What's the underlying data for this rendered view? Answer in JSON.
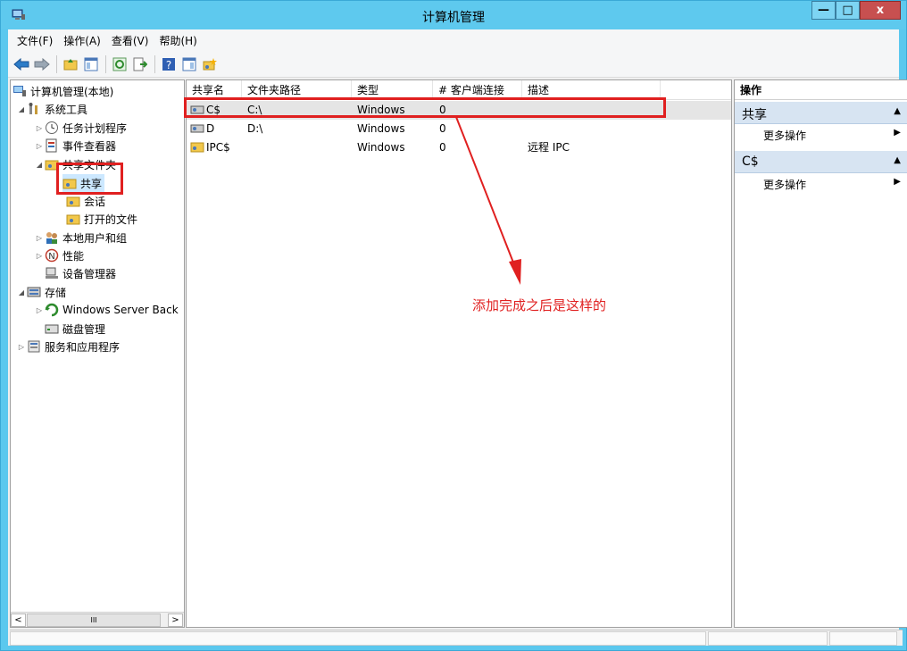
{
  "window": {
    "title": "计算机管理",
    "minimize": "—",
    "maximize": "□",
    "close": "x"
  },
  "menu": [
    "文件(F)",
    "操作(A)",
    "查看(V)",
    "帮助(H)"
  ],
  "tree": {
    "root": "计算机管理(本地)",
    "system_tools": "系统工具",
    "task_scheduler": "任务计划程序",
    "event_viewer": "事件查看器",
    "shared_folders": "共享文件夹",
    "shares": "共享",
    "sessions": "会话",
    "open_files": "打开的文件",
    "local_users": "本地用户和组",
    "performance": "性能",
    "device_manager": "设备管理器",
    "storage": "存储",
    "windows_backup": "Windows Server Back",
    "disk_mgmt": "磁盘管理",
    "services_apps": "服务和应用程序",
    "scroll_thumb": "III",
    "scroll_left": "<",
    "scroll_right": ">"
  },
  "list": {
    "columns": [
      "共享名",
      "文件夹路径",
      "类型",
      "# 客户端连接",
      "描述"
    ],
    "rows": [
      {
        "name": "C$",
        "path": "C:\\",
        "type": "Windows",
        "clients": "0",
        "desc": ""
      },
      {
        "name": "D",
        "path": "D:\\",
        "type": "Windows",
        "clients": "0",
        "desc": ""
      },
      {
        "name": "IPC$",
        "path": "",
        "type": "Windows",
        "clients": "0",
        "desc": "远程 IPC"
      }
    ]
  },
  "actions": {
    "title": "操作",
    "sections": [
      {
        "label": "共享",
        "item": "更多操作"
      },
      {
        "label": "C$",
        "item": "更多操作"
      }
    ]
  },
  "annotation": "添加完成之后是这样的",
  "colors": {
    "highlight": "#e02020",
    "titlebar": "#5ec9ee",
    "section_bg": "#d7e4f2"
  }
}
